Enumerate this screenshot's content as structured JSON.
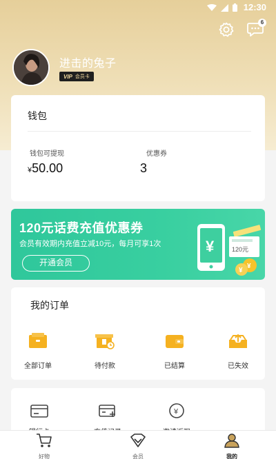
{
  "status_bar": {
    "time": "12:30"
  },
  "header": {
    "message_count": "6"
  },
  "profile": {
    "username": "进击的兔子",
    "vip_label": "VIP",
    "vip_card_label": "会员卡"
  },
  "wallet": {
    "title": "钱包",
    "withdrawable_label": "钱包可提现",
    "currency": "¥",
    "withdrawable_value": "50.00",
    "coupon_label": "优惠券",
    "coupon_value": "3"
  },
  "promo": {
    "title": "120元话费充值优惠券",
    "subtitle": "会员有效期内充值立减10元，每月可享1次",
    "button_label": "开通会员",
    "art_ticket_text": "120元",
    "art_phone_symbol": "¥"
  },
  "orders": {
    "title": "我的订单",
    "items": [
      {
        "label": "全部订单",
        "icon": "all-orders-icon"
      },
      {
        "label": "待付款",
        "icon": "pending-payment-icon"
      },
      {
        "label": "已结算",
        "icon": "settled-wallet-icon"
      },
      {
        "label": "已失效",
        "icon": "expired-tray-icon"
      }
    ]
  },
  "tools": {
    "items": [
      {
        "label": "银行卡",
        "icon": "bank-card-icon"
      },
      {
        "label": "充值记录",
        "icon": "recharge-record-icon"
      },
      {
        "label": "邀请返现",
        "icon": "invite-cashback-icon"
      }
    ]
  },
  "bottom_nav": {
    "items": [
      {
        "label": "好物",
        "icon": "cart-icon"
      },
      {
        "label": "会员",
        "icon": "diamond-icon"
      },
      {
        "label": "我的",
        "icon": "person-icon"
      }
    ],
    "active": "我的"
  },
  "colors": {
    "gold": "#e6cf9a",
    "accent": "#f5b120",
    "promo_green": "#2fc79b"
  }
}
